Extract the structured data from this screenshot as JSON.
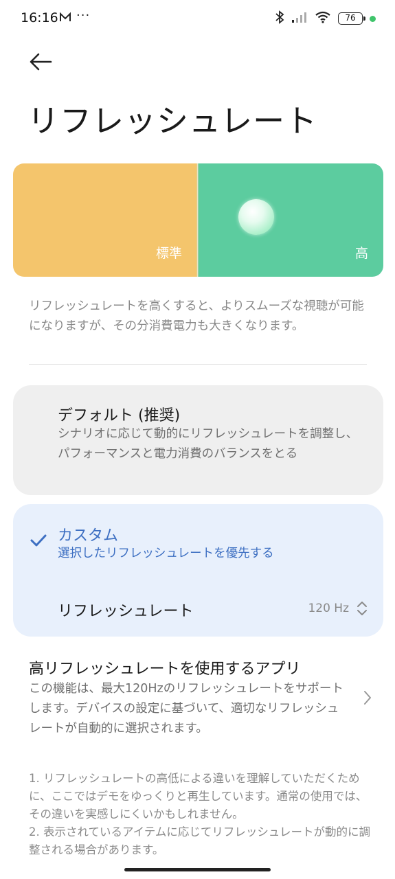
{
  "status_bar": {
    "time": "16:16",
    "more": "···",
    "battery": "76",
    "icons": [
      "mail-icon",
      "bluetooth-icon",
      "signal-icon",
      "wifi-icon",
      "battery-icon"
    ],
    "dot_color": "#3fc46b"
  },
  "header": {
    "back_icon": "arrow-left-icon",
    "title": "リフレッシュレート"
  },
  "preview": {
    "standard_label": "標準",
    "high_label": "高",
    "standard_color": "#f4c56c",
    "high_color": "#5ccc9f"
  },
  "description": "リフレッシュレートを高くすると、よりスムーズな視聴が可能になりますが、その分消費電力も大きくなります。",
  "options": {
    "default": {
      "title": "デフォルト (推奨)",
      "subtitle": "シナリオに応じて動的にリフレッシュレートを調整し、パフォーマンスと電力消費のバランスをとる",
      "selected": false
    },
    "custom": {
      "title": "カスタム",
      "subtitle": "選択したリフレッシュレートを優先する",
      "selected": true,
      "rate_label": "リフレッシュレート",
      "rate_value": "120 Hz"
    }
  },
  "apps": {
    "title": "高リフレッシュレートを使用するアプリ",
    "subtitle": "この機能は、最大120Hzのリフレッシュレートをサポートします。デバイスの設定に基づいて、適切なリフレッシュ レートが自動的に選択されます。"
  },
  "notes": [
    "1. リフレッシュレートの高低による違いを理解していただくために、ここではデモをゆっくりと再生しています。通常の使用では、その違いを実感しにくいかもしれません。",
    "2. 表示されているアイテムに応じてリフレッシュレートが動的に調整される場合があります。"
  ],
  "accent_color": "#3d6fc2"
}
